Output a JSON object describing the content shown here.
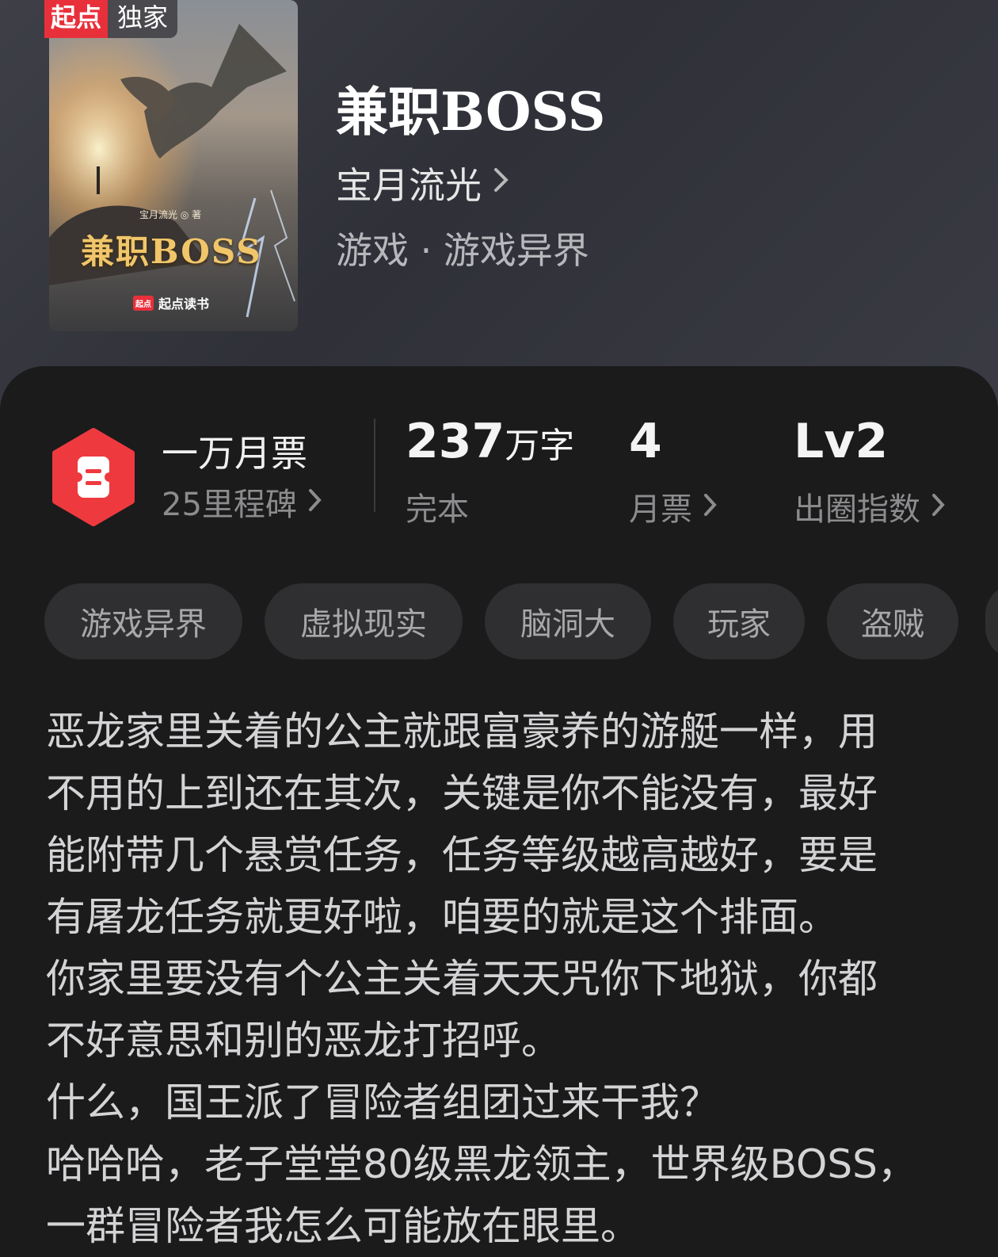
{
  "badge": {
    "brand": "起点",
    "label": "独家"
  },
  "cover": {
    "author": "宝月流光 ◎ 著",
    "title": "兼职BOSS",
    "publisher_logo": "起点",
    "publisher": "起点读书"
  },
  "book": {
    "title": "兼职BOSS",
    "author": "宝月流光",
    "genre": "游戏 · 游戏异界"
  },
  "stats": {
    "milestone_title": "一万月票",
    "milestone_sub": "25里程碑",
    "words_value": "237",
    "words_unit": "万字",
    "words_status": "完本",
    "monthly_votes_value": "4",
    "monthly_votes_label": "月票",
    "influence_value": "Lv2",
    "influence_label": "出圈指数"
  },
  "tags": [
    "游戏异界",
    "虚拟现实",
    "脑洞大",
    "玩家",
    "盗贼"
  ],
  "description": [
    "恶龙家里关着的公主就跟富豪养的游艇一样，用",
    "不用的上到还在其次，关键是你不能没有，最好",
    "能附带几个悬赏任务，任务等级越高越好，要是",
    "有屠龙任务就更好啦，咱要的就是这个排面。",
    "你家里要没有个公主关着天天咒你下地狱，你都",
    "不好意思和别的恶龙打招呼。",
    "什么，国王派了冒险者组团过来干我？",
    "哈哈哈，老子堂堂80级黑龙领主，世界级BOSS，",
    "一群冒险者我怎么可能放在眼里。"
  ],
  "colors": {
    "brand_red": "#e8303b",
    "panel_bg": "#1b1b1c",
    "tag_bg": "#2f2f31"
  }
}
